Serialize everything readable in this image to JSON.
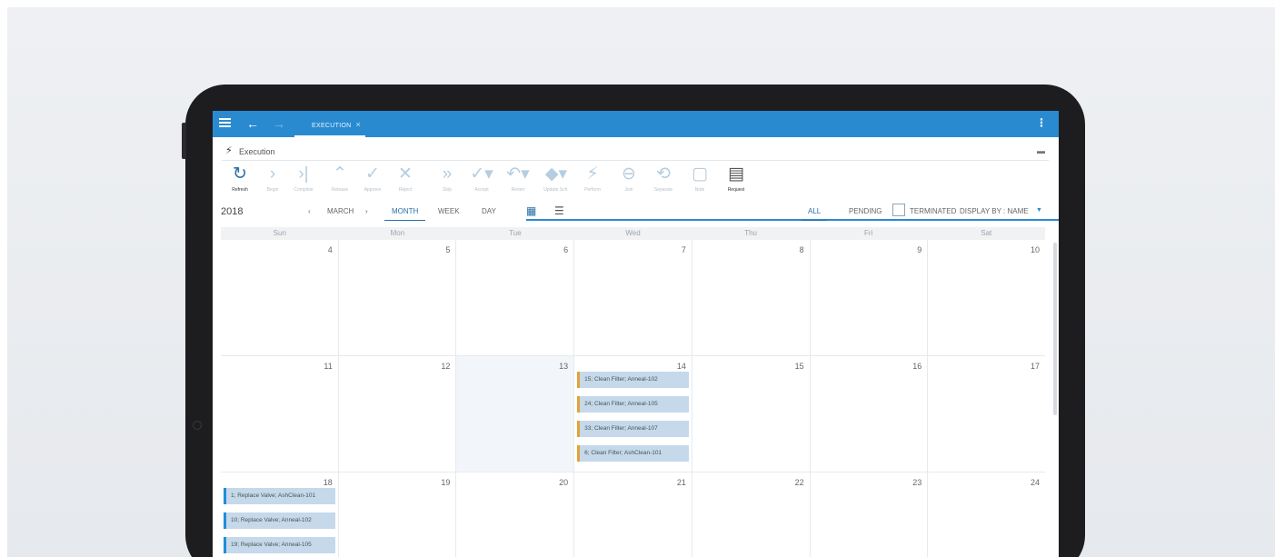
{
  "header": {
    "tab_label": "EXECUTION",
    "tab_close": "×"
  },
  "page": {
    "title": "Execution"
  },
  "toolbar": [
    {
      "label": "Refresh",
      "glyph": "↻",
      "state": "enabled"
    },
    {
      "label": "Begin",
      "glyph": "›",
      "state": "disabled"
    },
    {
      "label": "Complete",
      "glyph": "›|",
      "state": "disabled"
    },
    {
      "label": "Release",
      "glyph": "⌃",
      "state": "disabled"
    },
    {
      "label": "Approve",
      "glyph": "✓",
      "state": "disabled"
    },
    {
      "label": "Reject",
      "glyph": "✕",
      "state": "disabled"
    },
    {
      "label": "Skip",
      "glyph": "»",
      "state": "disabled"
    },
    {
      "label": "Accept",
      "glyph": "✓▾",
      "state": "disabled"
    },
    {
      "label": "Revert",
      "glyph": "↶▾",
      "state": "disabled"
    },
    {
      "label": "Update Sch.",
      "glyph": "◆▾",
      "state": "disabled"
    },
    {
      "label": "Perform",
      "glyph": "⚡",
      "state": "disabled"
    },
    {
      "label": "Join",
      "glyph": "⊖",
      "state": "disabled"
    },
    {
      "label": "Separate",
      "glyph": "⟲",
      "state": "disabled"
    },
    {
      "label": "Note",
      "glyph": "▢",
      "state": "disabled"
    },
    {
      "label": "Request",
      "glyph": "▤",
      "state": "enabled"
    }
  ],
  "controls": {
    "year": "2018",
    "prev": "‹",
    "month": "MARCH",
    "next": "›",
    "views": [
      "MONTH",
      "WEEK",
      "DAY"
    ],
    "filters": [
      "ALL",
      "PENDING"
    ],
    "terminated_label": "TERMINATED",
    "display_by": "DISPLAY BY : NAME"
  },
  "calendar": {
    "weekdays": [
      "Sun",
      "Mon",
      "Tue",
      "Wed",
      "Thu",
      "Fri",
      "Sat"
    ],
    "weeks": [
      {
        "days": [
          {
            "n": "4",
            "events": []
          },
          {
            "n": "5",
            "events": []
          },
          {
            "n": "6",
            "events": []
          },
          {
            "n": "7",
            "events": []
          },
          {
            "n": "8",
            "events": []
          },
          {
            "n": "9",
            "events": []
          },
          {
            "n": "10",
            "events": []
          }
        ]
      },
      {
        "days": [
          {
            "n": "11",
            "events": []
          },
          {
            "n": "12",
            "events": []
          },
          {
            "n": "13",
            "today": true,
            "events": []
          },
          {
            "n": "14",
            "events": [
              {
                "text": "15; Clean Filter; Anneal-102",
                "color": "amber"
              },
              {
                "text": "24; Clean Filter; Anneal-105",
                "color": "amber"
              },
              {
                "text": "33; Clean Filter; Anneal-107",
                "color": "amber"
              },
              {
                "text": "6; Clean Filter; AshClean-101",
                "color": "amber"
              }
            ]
          },
          {
            "n": "15",
            "events": []
          },
          {
            "n": "16",
            "events": []
          },
          {
            "n": "17",
            "events": []
          }
        ]
      },
      {
        "days": [
          {
            "n": "18",
            "events": [
              {
                "text": "1; Replace Valve; AshClean-101",
                "color": "blue"
              },
              {
                "text": "10; Replace Valve; Anneal-102",
                "color": "blue"
              },
              {
                "text": "19; Replace Valve; Anneal-105",
                "color": "blue"
              }
            ]
          },
          {
            "n": "19",
            "events": []
          },
          {
            "n": "20",
            "events": []
          },
          {
            "n": "21",
            "events": []
          },
          {
            "n": "22",
            "events": []
          },
          {
            "n": "23",
            "events": []
          },
          {
            "n": "24",
            "events": []
          }
        ]
      }
    ]
  },
  "colors": {
    "brand_blue": "#2a8ad0",
    "event_amber": "#e1a23c",
    "event_blue": "#1f8ed8",
    "event_fill": "#c5d9ea"
  }
}
